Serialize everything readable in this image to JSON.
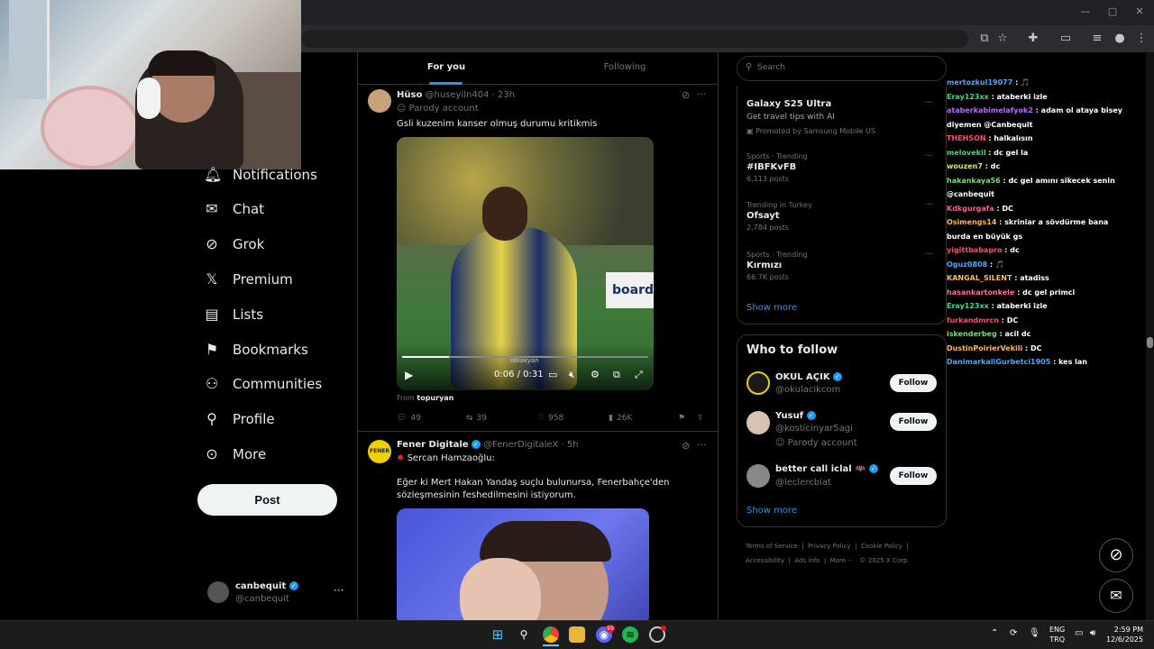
{
  "browser": {
    "window_controls": [
      "—",
      "▢",
      "✕"
    ]
  },
  "sidebar": {
    "items": [
      {
        "label": "Notifications",
        "icon": "bell-icon"
      },
      {
        "label": "Chat",
        "icon": "mail-icon"
      },
      {
        "label": "Grok",
        "icon": "grok-icon"
      },
      {
        "label": "Premium",
        "icon": "x-logo-icon"
      },
      {
        "label": "Lists",
        "icon": "list-icon"
      },
      {
        "label": "Bookmarks",
        "icon": "bookmark-icon"
      },
      {
        "label": "Communities",
        "icon": "communities-icon"
      },
      {
        "label": "Profile",
        "icon": "person-icon"
      },
      {
        "label": "More",
        "icon": "more-circle-icon"
      }
    ],
    "post_label": "Post",
    "account": {
      "name": "canbequit",
      "handle": "@canbequit"
    }
  },
  "tabs": {
    "for_you": "For you",
    "following": "Following"
  },
  "tweets": [
    {
      "name": "Hüso",
      "handle": "@huseyiln404",
      "time": "23h",
      "badge": "Parody account",
      "text": "Gsli kuzenim kanser olmuş durumu kritikmis",
      "video_time": "0:06 / 0:31",
      "video_watermark": "oblakyan",
      "from_label": "From",
      "from_name": "topuryan",
      "replies": "49",
      "reposts": "39",
      "likes": "958",
      "views": "26K"
    },
    {
      "name": "Fener Digitale",
      "handle": "@FenerDigitaleX",
      "time": "5h",
      "line1": "Sercan Hamzaoğlu:",
      "text": "Eğer ki Mert Hakan Yandaş suçlu bulunursa, Fenerbahçe'den sözleşmesinin feshedilmesini istiyorum."
    }
  ],
  "search": {
    "placeholder": "Search"
  },
  "promo": {
    "title": "Galaxy S25 Ultra",
    "subtitle": "Get travel tips with AI",
    "promoted": "Promoted by Samsung Mobile US"
  },
  "trends": [
    {
      "meta": "Sports · Trending",
      "title": "#IBFKvFB",
      "posts": "6,113 posts"
    },
    {
      "meta": "Trending in Turkey",
      "title": "Ofsayt",
      "posts": "2,784 posts"
    },
    {
      "meta": "Sports · Trending",
      "title": "Kırmızı",
      "posts": "66.7K posts"
    }
  ],
  "show_more": "Show more",
  "who_to_follow": {
    "title": "Who to follow",
    "accounts": [
      {
        "name": "OKUL AÇIK",
        "handle": "@okulacikcom",
        "badge": "",
        "button": "Follow"
      },
      {
        "name": "Yusuf",
        "handle": "@kosticinyar5agi",
        "badge": "Parody account",
        "button": "Follow"
      },
      {
        "name": "better call iclal 🦇",
        "handle": "@leclercbiat",
        "badge": "",
        "button": "Follow"
      }
    ],
    "show_more": "Show more"
  },
  "footer": {
    "links": [
      "Terms of Service",
      "Privacy Policy",
      "Cookie Policy",
      "Accessibility",
      "Ads info",
      "More ···",
      "© 2025 X Corp."
    ]
  },
  "chat": [
    {
      "user": "mertozkul19077",
      "msg": "🎵",
      "color": "#4aa8ff"
    },
    {
      "user": "Eray123xx",
      "msg": "ataberki izle",
      "color": "#3ddc84"
    },
    {
      "user": "ataberkabimelafyok2",
      "msg": "adam ol ataya bisey diyemen @Canbequit",
      "color": "#b86bff"
    },
    {
      "user": "THEHSON",
      "msg": "halkalısın",
      "color": "#ff4d6d"
    },
    {
      "user": "melovekil",
      "msg": "dc gel la",
      "color": "#3ddc84"
    },
    {
      "user": "wouzen7",
      "msg": "dc",
      "color": "#e6e64a"
    },
    {
      "user": "hakankaya56",
      "msg": "dc gel amını sikecek senin @canbequit",
      "color": "#7dd87d"
    },
    {
      "user": "Kdkgurgafa",
      "msg": "DC",
      "color": "#ff5c8a"
    },
    {
      "user": "Osimengs14",
      "msg": "skriniar a sövdürme bana burda en büyük gs",
      "color": "#ffb84d"
    },
    {
      "user": "yigittbabapro",
      "msg": "dc",
      "color": "#ff4d6d"
    },
    {
      "user": "Oguz0808",
      "msg": "🎵",
      "color": "#4aa8ff"
    },
    {
      "user": "KANGAL_SILENT",
      "msg": "atadiss",
      "color": "#ffb84d"
    },
    {
      "user": "hasankartonkele",
      "msg": "dc gel primci",
      "color": "#ff6b9d"
    },
    {
      "user": "Eray123xx",
      "msg": "ataberki izle",
      "color": "#3ddc84"
    },
    {
      "user": "furkandmrcn",
      "msg": "DC",
      "color": "#ff4d6d"
    },
    {
      "user": "iskenderbeg",
      "msg": "acil dc",
      "color": "#7dd87d"
    },
    {
      "user": "DustinPoirierVekili",
      "msg": "DC",
      "color": "#ffb84d"
    },
    {
      "user": "DanimarkaliGurbetci1905",
      "msg": "kes lan",
      "color": "#4aa8ff"
    }
  ],
  "taskbar": {
    "lang": "ENG",
    "locale": "TRQ",
    "time": "2:59 PM",
    "date": "12/6/2025",
    "discord_badge": "99"
  }
}
